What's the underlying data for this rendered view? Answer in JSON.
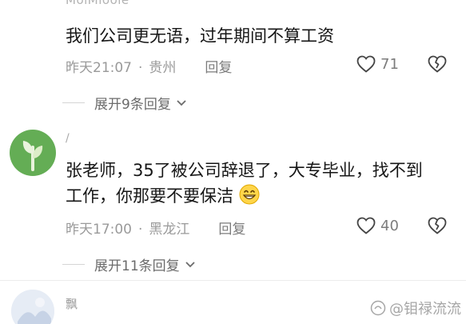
{
  "comments": [
    {
      "username": "MoiMiooie",
      "text": "我们公司更无语，过年期间不算工资",
      "time": "昨天21:07",
      "location": "贵州",
      "reply_label": "回复",
      "likes": "71",
      "expand_label": "展开9条回复"
    },
    {
      "username": "/",
      "text_line1": "张老师，35了被公司辞退了，大专毕业，找不到",
      "text_line2": "工作，你那要不要保洁",
      "emoji": "grinning-face-emoji",
      "time": "昨天17:00",
      "location": "黑龙江",
      "reply_label": "回复",
      "likes": "40",
      "expand_label": "展开11条回复"
    },
    {
      "username": "飘",
      "text_partial": "……"
    }
  ],
  "watermark": "@钼禄流流",
  "colors": {
    "avatar_green": "#64ad55",
    "meta_gray": "#9a9a9a"
  }
}
